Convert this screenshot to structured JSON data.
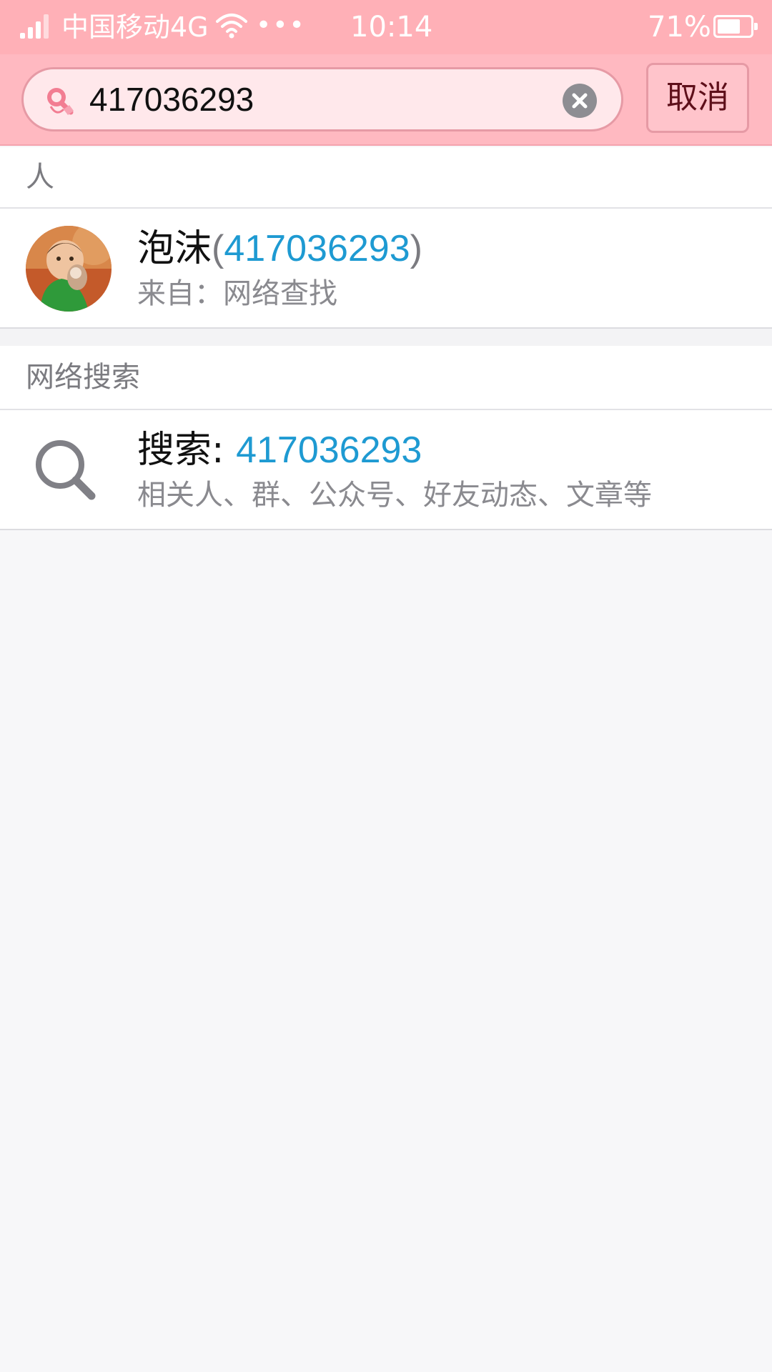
{
  "status_bar": {
    "carrier": "中国移动4G",
    "more": "•••",
    "time": "10:14",
    "battery_percent": "71%",
    "battery_level": 0.71
  },
  "search": {
    "query": "417036293",
    "cancel_label": "取消"
  },
  "people_section": {
    "header": "人",
    "results": [
      {
        "name": "泡沫",
        "paren_open": "(",
        "number": "417036293",
        "paren_close": ")",
        "source": "来自：网络查找"
      }
    ]
  },
  "web_section": {
    "header": "网络搜索",
    "result": {
      "prefix": "搜索:",
      "query": "417036293",
      "description": "相关人、群、公众号、好友动态、文章等"
    }
  },
  "colors": {
    "status_bar_bg": "#ffb0b7",
    "header_bg": "#ffb9c1",
    "accent_number": "#1e9ad2",
    "page_bg": "#f7f7f9"
  }
}
